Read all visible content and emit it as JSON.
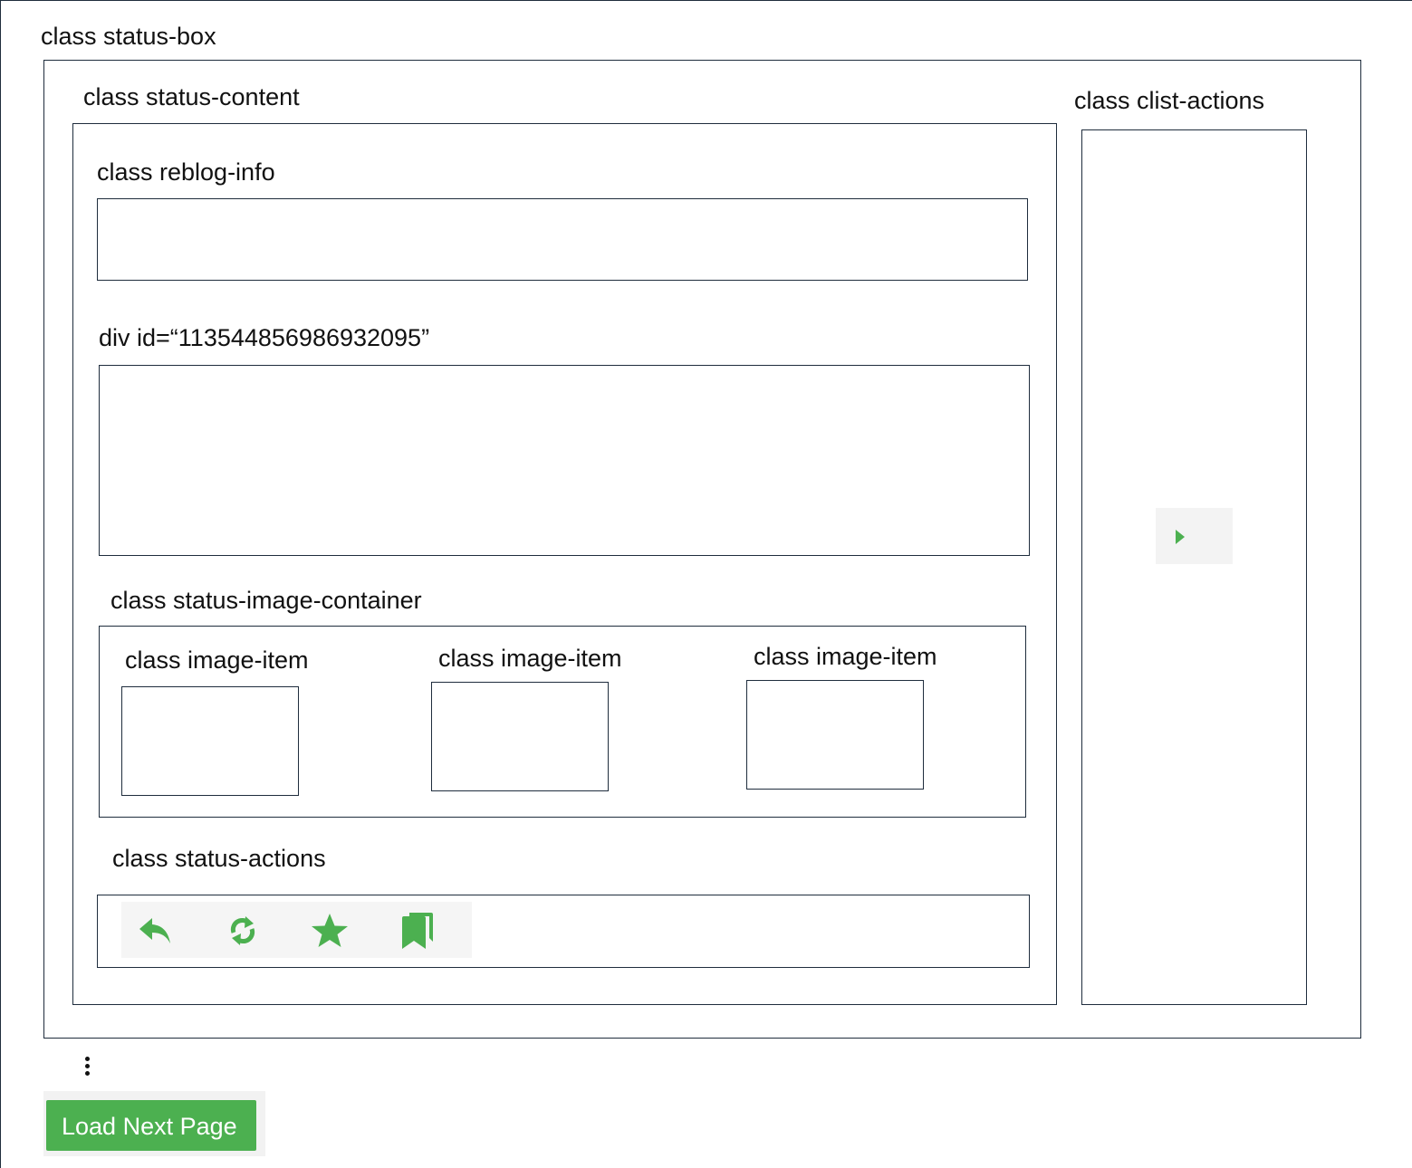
{
  "labels": {
    "status_box": "class status-box",
    "status_content": "class status-content",
    "clist_actions": "class clist-actions",
    "reblog_info": "class reblog-info",
    "div_id": "div id=“113544856986932095”",
    "status_image_container": "class status-image-container",
    "image_items": [
      "class image-item",
      "class image-item",
      "class image-item"
    ],
    "status_actions": "class status-actions"
  },
  "status_actions_icons": [
    "reply-icon",
    "boost-icon",
    "star-icon",
    "bookmark-icon"
  ],
  "clist_actions_icon": "play-arrow-icon",
  "more_indicator_icon": "vertical-ellipsis-icon",
  "load_button": {
    "label": "Load Next Page"
  },
  "colors": {
    "accent": "#4cb050",
    "border": "#1f2d3d",
    "icon_bg": "#f5f5f5"
  }
}
